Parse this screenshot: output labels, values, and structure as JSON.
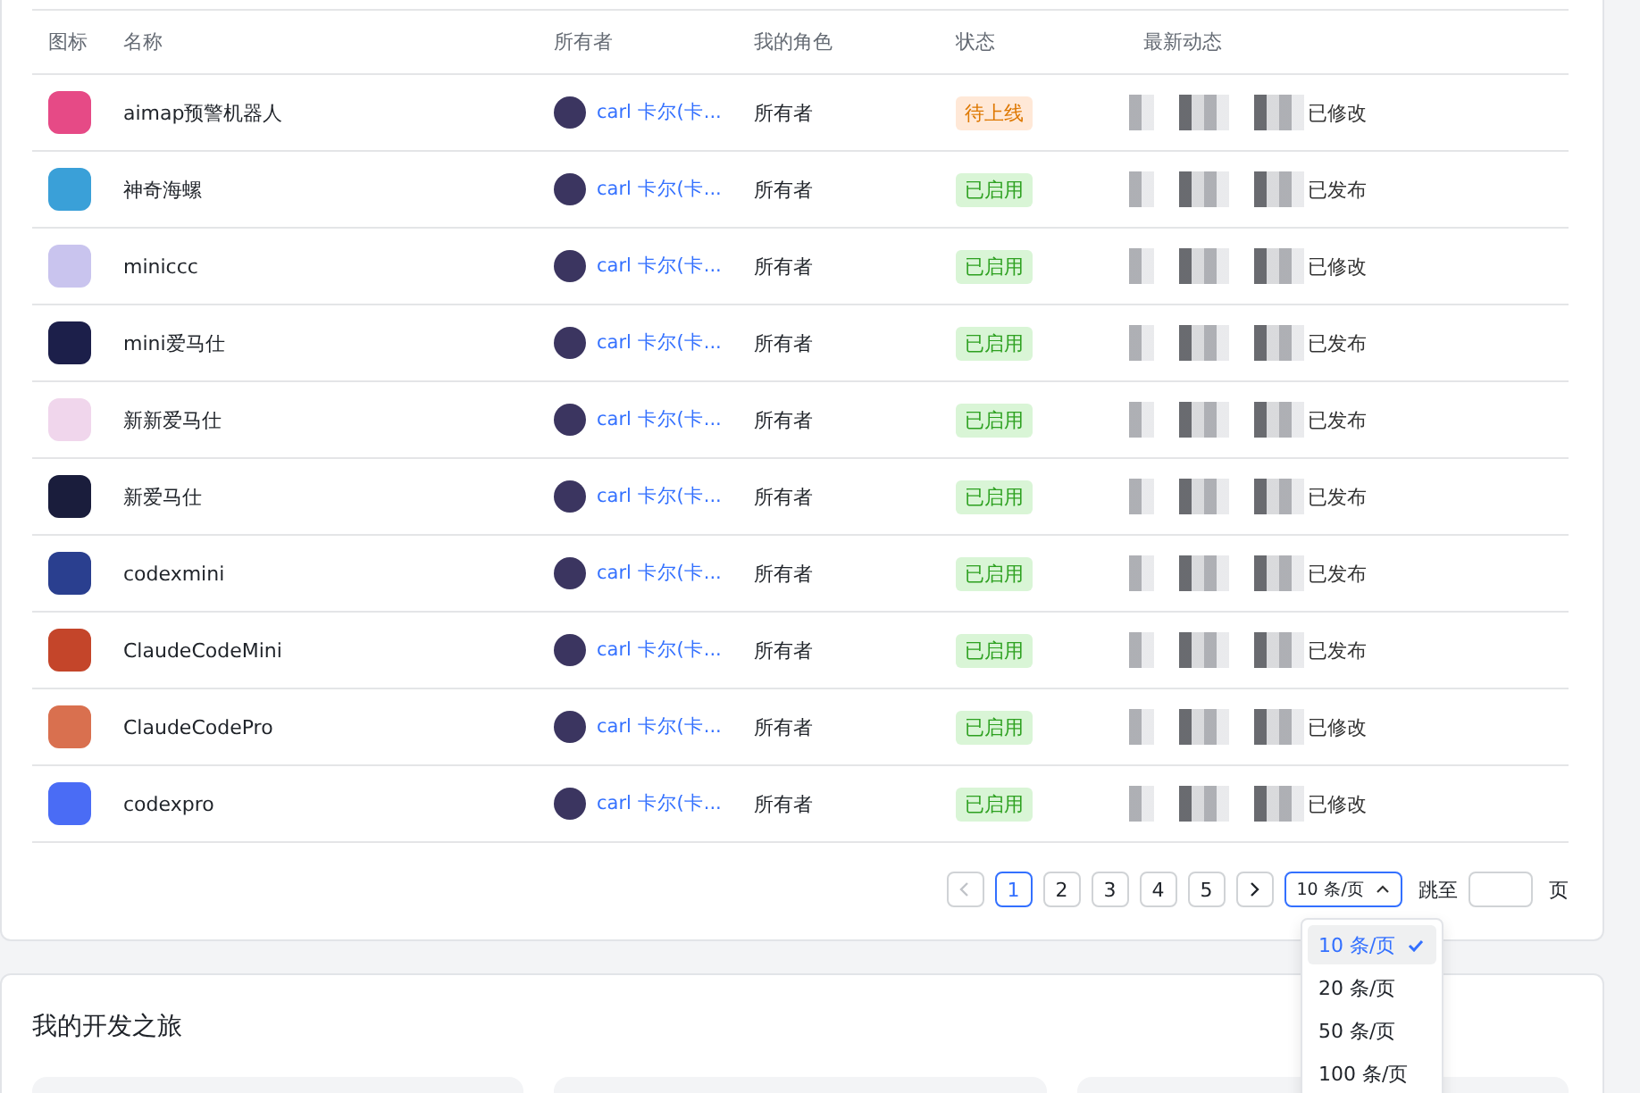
{
  "table": {
    "columns": [
      "图标",
      "名称",
      "所有者",
      "我的角色",
      "状态",
      "最新动态"
    ],
    "rows": [
      {
        "color": "#e64a86",
        "name": "aimap预警机器人",
        "owner": "carl 卡尔(卡...",
        "role": "所有者",
        "status": {
          "text": "待上线",
          "kind": "pending"
        },
        "activity": "已修改"
      },
      {
        "color": "#3aa0d8",
        "name": "神奇海螺",
        "owner": "carl 卡尔(卡...",
        "role": "所有者",
        "status": {
          "text": "已启用",
          "kind": "enabled"
        },
        "activity": "已发布"
      },
      {
        "color": "#c9c4ee",
        "name": "miniccc",
        "owner": "carl 卡尔(卡...",
        "role": "所有者",
        "status": {
          "text": "已启用",
          "kind": "enabled"
        },
        "activity": "已修改"
      },
      {
        "color": "#1c1f4a",
        "name": "mini爱马仕",
        "owner": "carl 卡尔(卡...",
        "role": "所有者",
        "status": {
          "text": "已启用",
          "kind": "enabled"
        },
        "activity": "已发布"
      },
      {
        "color": "#f0d6ec",
        "name": "新新爱马仕",
        "owner": "carl 卡尔(卡...",
        "role": "所有者",
        "status": {
          "text": "已启用",
          "kind": "enabled"
        },
        "activity": "已发布"
      },
      {
        "color": "#1a1d3c",
        "name": "新爱马仕",
        "owner": "carl 卡尔(卡...",
        "role": "所有者",
        "status": {
          "text": "已启用",
          "kind": "enabled"
        },
        "activity": "已发布"
      },
      {
        "color": "#2a3f8f",
        "name": "codexmini",
        "owner": "carl 卡尔(卡...",
        "role": "所有者",
        "status": {
          "text": "已启用",
          "kind": "enabled"
        },
        "activity": "已发布"
      },
      {
        "color": "#c4452a",
        "name": "ClaudeCodeMini",
        "owner": "carl 卡尔(卡...",
        "role": "所有者",
        "status": {
          "text": "已启用",
          "kind": "enabled"
        },
        "activity": "已发布"
      },
      {
        "color": "#d9704f",
        "name": "ClaudeCodePro",
        "owner": "carl 卡尔(卡...",
        "role": "所有者",
        "status": {
          "text": "已启用",
          "kind": "enabled"
        },
        "activity": "已修改"
      },
      {
        "color": "#4a6cf5",
        "name": "codexpro",
        "owner": "carl 卡尔(卡...",
        "role": "所有者",
        "status": {
          "text": "已启用",
          "kind": "enabled"
        },
        "activity": "已修改"
      }
    ]
  },
  "pagination": {
    "prev_disabled": true,
    "pages": [
      {
        "label": "1",
        "selected": true
      },
      {
        "label": "2",
        "selected": false
      },
      {
        "label": "3",
        "selected": false
      },
      {
        "label": "4",
        "selected": false
      },
      {
        "label": "5",
        "selected": false
      }
    ],
    "page_size": "10 条/页",
    "jump_label": "跳至",
    "page_unit": "页",
    "page_size_options": [
      {
        "label": "10 条/页",
        "selected": true
      },
      {
        "label": "20 条/页",
        "selected": false
      },
      {
        "label": "50 条/页",
        "selected": false
      },
      {
        "label": "100 条/页",
        "selected": false
      }
    ]
  },
  "journey": {
    "title": "我的开发之旅"
  }
}
